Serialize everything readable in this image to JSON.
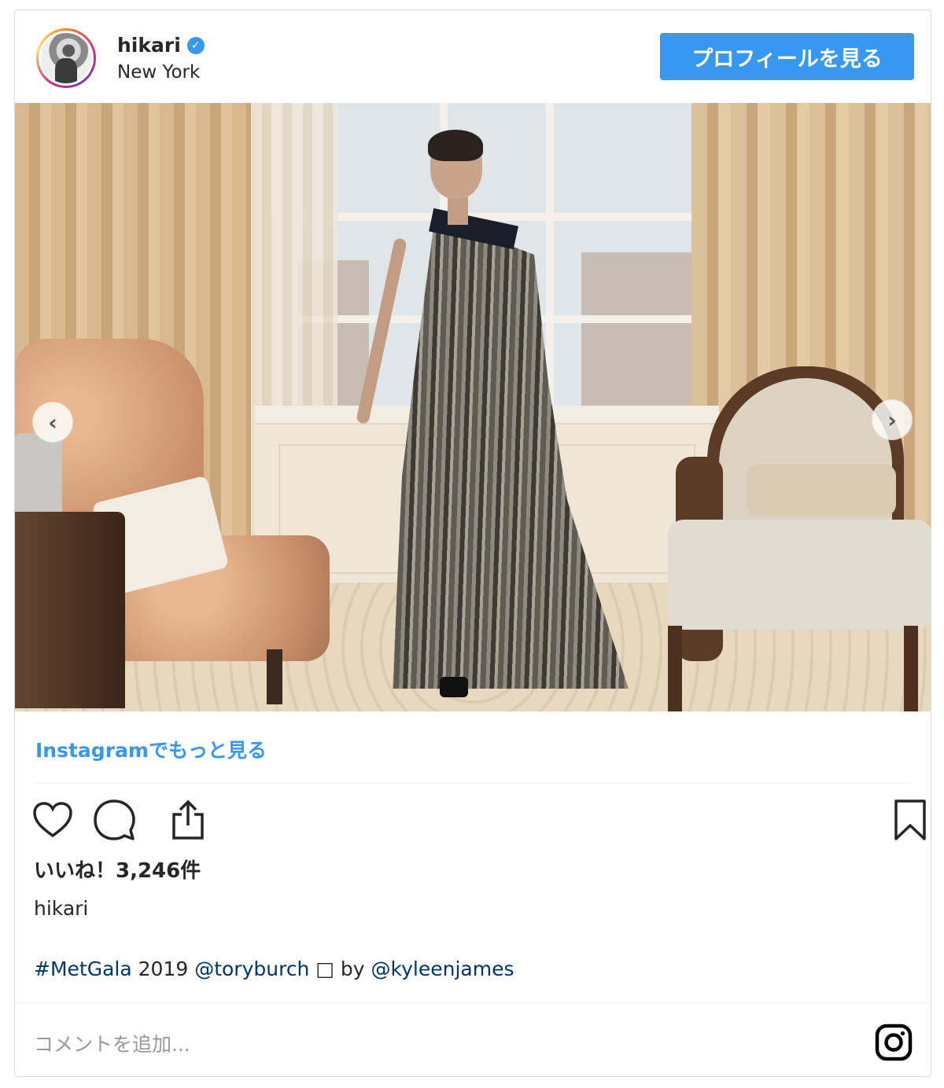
{
  "header": {
    "username": "hikari",
    "verified_icon": "verified-badge-icon",
    "location": "New York",
    "profile_button": "プロフィールを見る"
  },
  "photo": {
    "prev_icon": "chevron-left-icon",
    "next_icon": "chevron-right-icon",
    "prev_glyph": "‹",
    "next_glyph": "›"
  },
  "more_link": "Instagramでもっと見る",
  "actions": {
    "like_icon": "heart-icon",
    "comment_icon": "comment-bubble-icon",
    "share_icon": "share-icon",
    "save_icon": "bookmark-icon"
  },
  "likes": "いいね！3,246件",
  "caption": {
    "user": "hikari",
    "hashtag": "#MetGala",
    "text1": " 2019 ",
    "mention1": "@toryburch",
    "text2": " □ by ",
    "mention2": "@kyleenjames"
  },
  "comment_placeholder": "コメントを追加...",
  "colors": {
    "accent": "#3897f0",
    "link": "#003569",
    "border": "#dbdbdb"
  }
}
